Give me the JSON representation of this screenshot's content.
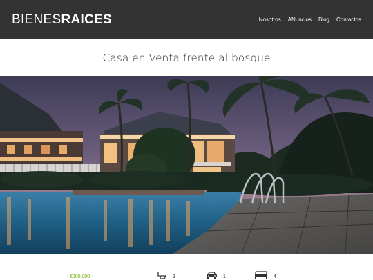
{
  "header": {
    "logo_thin": "BIENES",
    "logo_bold": "RAICES",
    "nav": [
      "Nosotros",
      "ANuncios",
      "Blog",
      "Contactos"
    ]
  },
  "listing": {
    "title": "Casa en Venta frente al bosque",
    "price": "€200.000",
    "bathrooms": "3",
    "parking": "1",
    "bedrooms": "4"
  },
  "colors": {
    "header_bg": "#333333",
    "price": "#71b100"
  },
  "icons": {
    "bathrooms": "toilet-icon",
    "parking": "car-icon",
    "bedrooms": "bed-icon"
  }
}
